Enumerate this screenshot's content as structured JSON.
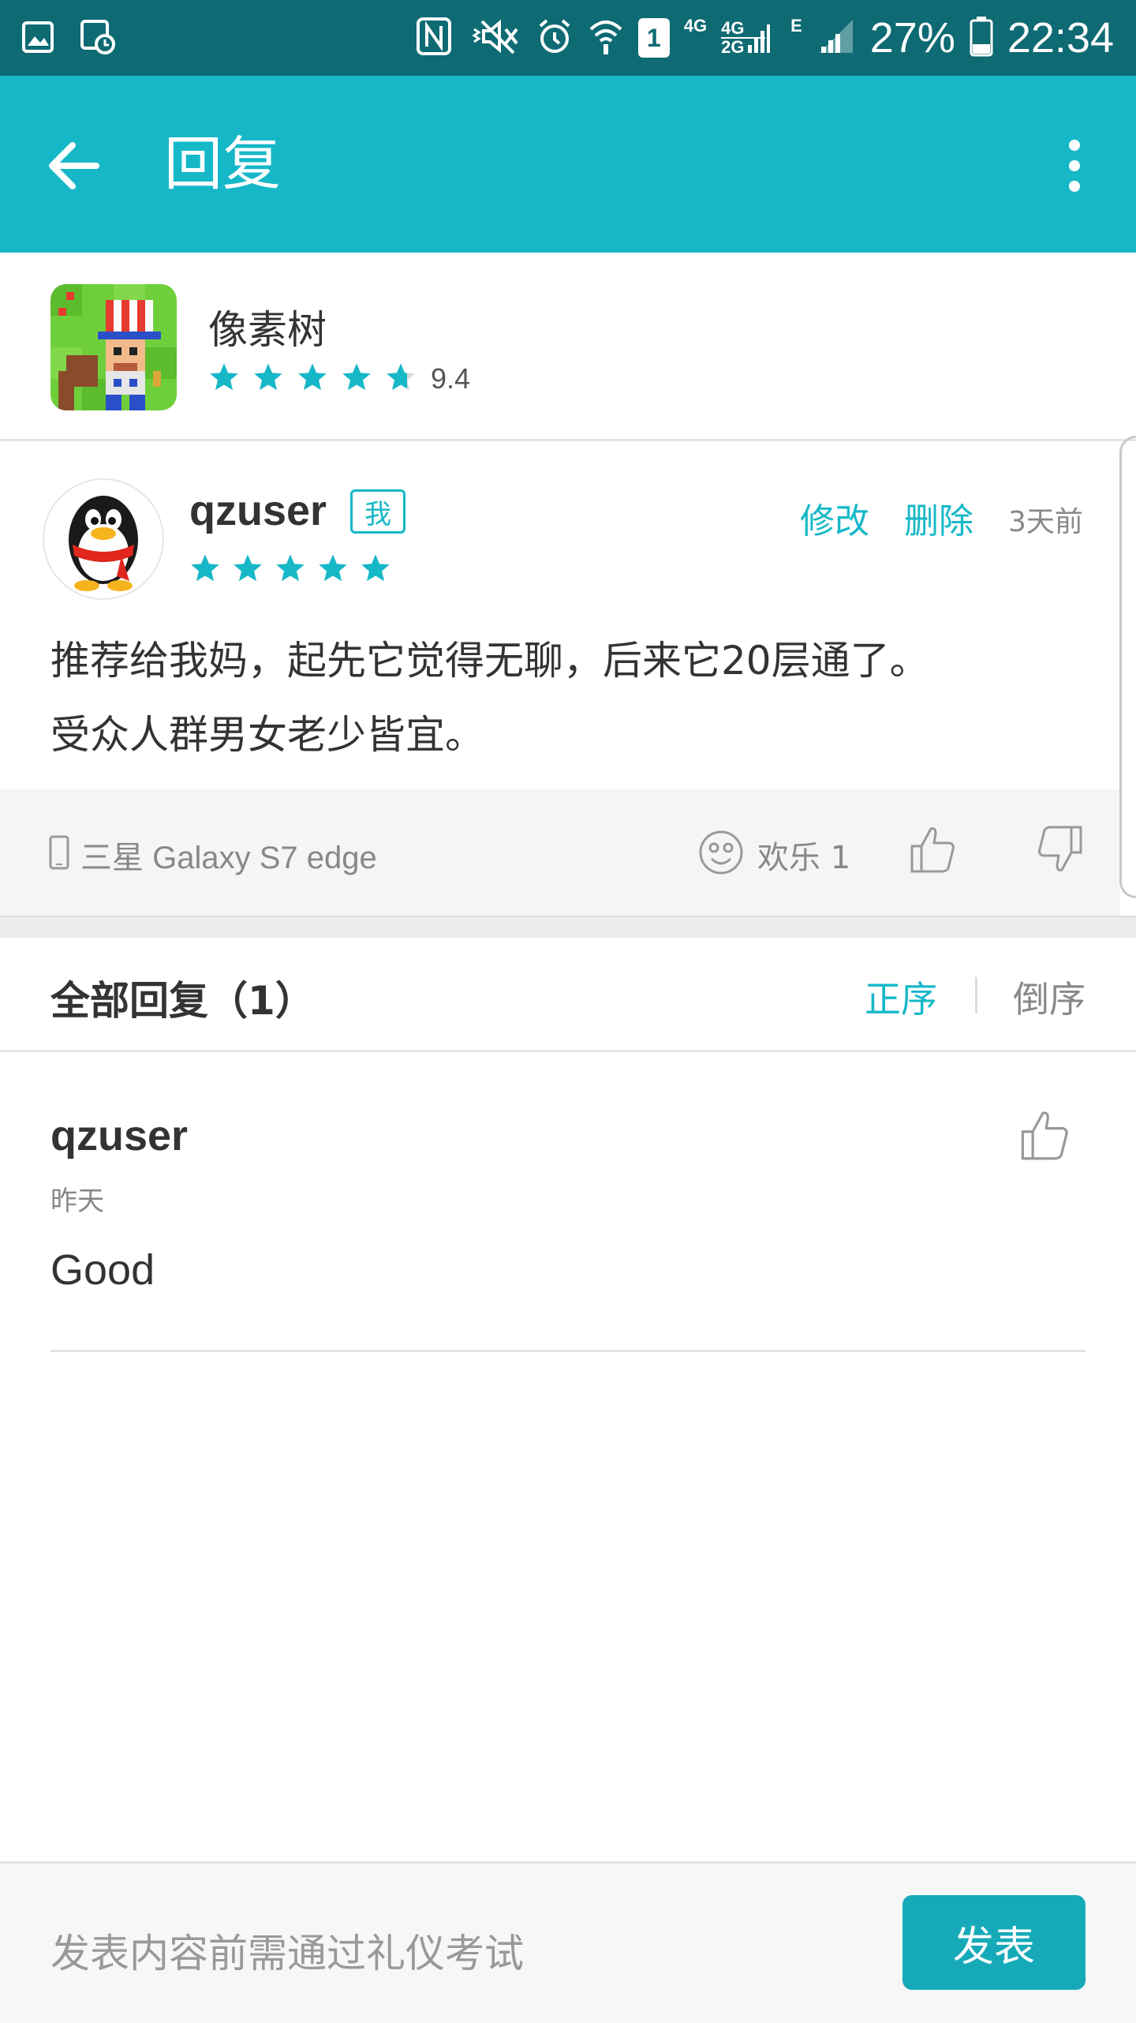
{
  "status_bar": {
    "signal_sim": "1",
    "network_4g": "4G",
    "network_4g2g_top": "4G",
    "network_4g2g_bottom": "2G",
    "network_e": "E",
    "battery": "27%",
    "time": "22:34"
  },
  "app_bar": {
    "title": "回复"
  },
  "app": {
    "name": "像素树",
    "rating_value": "9.4",
    "rating_stars": 4.7
  },
  "review": {
    "username": "qzuser",
    "me_badge": "我",
    "stars": 5,
    "edit_label": "修改",
    "delete_label": "删除",
    "time": "3天前",
    "text_line1": "推荐给我妈，起先它觉得无聊，后来它20层通了。",
    "text_line2": "受众人群男女老少皆宜。",
    "device": "三星 Galaxy S7 edge",
    "emotion_label": "欢乐 1"
  },
  "replies": {
    "header": "全部回复（1）",
    "sort_asc": "正序",
    "sort_desc": "倒序",
    "items": [
      {
        "username": "qzuser",
        "time": "昨天",
        "text": "Good"
      }
    ]
  },
  "composer": {
    "placeholder": "发表内容前需通过礼仪考试",
    "send_label": "发表"
  },
  "colors": {
    "accent": "#16b8c8",
    "status_bar": "#0e6a73"
  }
}
